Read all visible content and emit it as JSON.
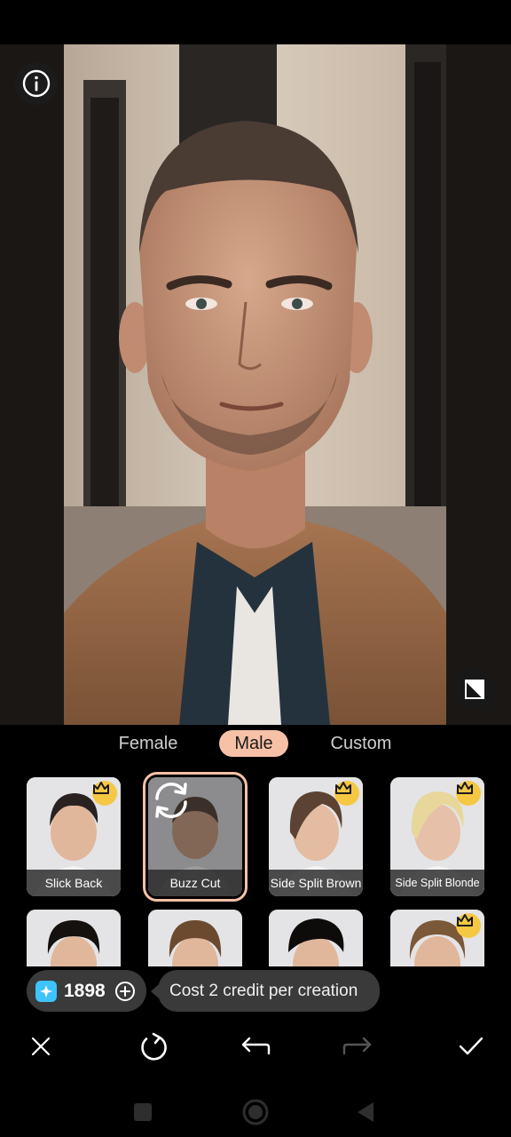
{
  "tabs": {
    "female": "Female",
    "male": "Male",
    "custom": "Custom",
    "selected": "Male"
  },
  "styles": [
    {
      "label": "Slick Back",
      "premium": true,
      "selected": false
    },
    {
      "label": "Buzz Cut",
      "premium": false,
      "selected": true
    },
    {
      "label": "Side Split Brown",
      "premium": true,
      "selected": false
    },
    {
      "label": "Side Split Blonde",
      "premium": true,
      "selected": false
    },
    {
      "label": "",
      "premium": false,
      "selected": false
    },
    {
      "label": "",
      "premium": false,
      "selected": false
    },
    {
      "label": "",
      "premium": false,
      "selected": false
    },
    {
      "label": "",
      "premium": true,
      "selected": false
    }
  ],
  "credits": {
    "count": "1898",
    "tooltip": "Cost 2 credit per creation"
  },
  "icons": {
    "info": "info-icon",
    "compare": "compare-icon",
    "crown": "crown-icon",
    "credit": "sparkle-gem-icon",
    "add": "plus-circle-icon",
    "close": "close-icon",
    "regenerate": "refresh-icon",
    "undo": "undo-icon",
    "redo": "redo-icon",
    "confirm": "check-icon"
  },
  "colors": {
    "accent": "#f6c1a6",
    "crown": "#f5c844",
    "gem": "#3ec3ff",
    "panel": "#000000",
    "pill": "#3a3a3a"
  }
}
